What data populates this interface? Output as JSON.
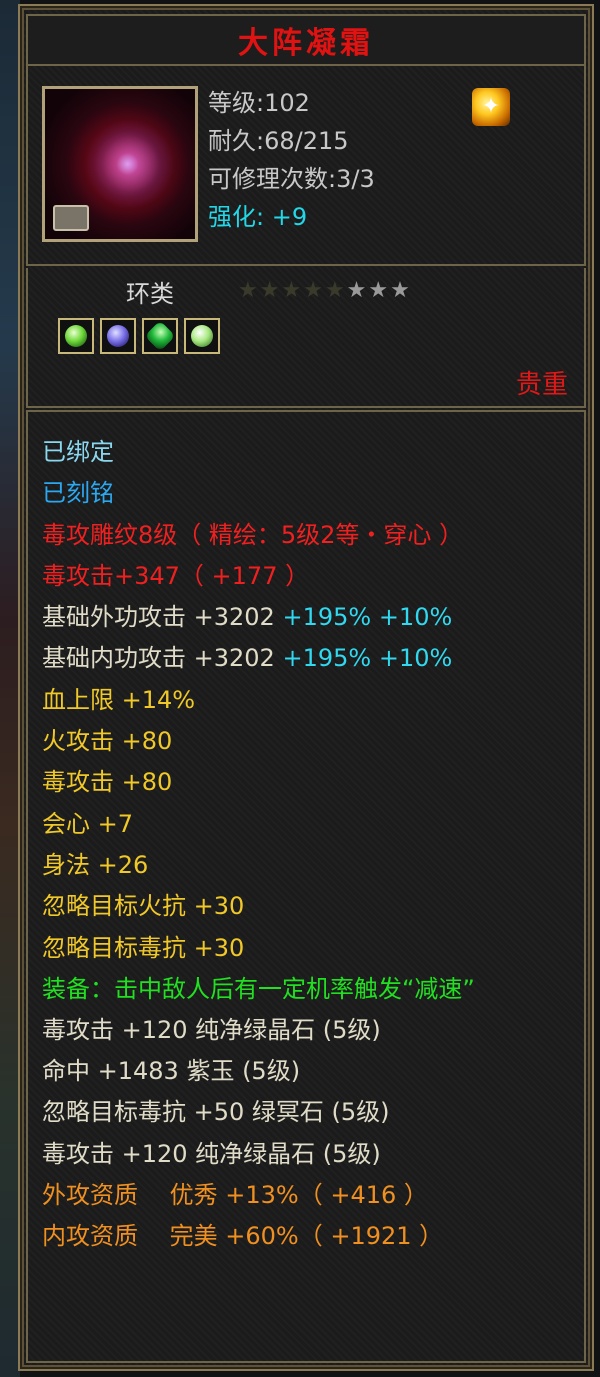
{
  "item": {
    "name": "大阵凝霜",
    "level": "等级:102",
    "durability": "耐久:68/215",
    "repair": "可修理次数:3/3",
    "enhance_label": "强化:",
    "enhance_value": "+9",
    "category": "环类",
    "rarity": "贵重",
    "stars_total": 8,
    "stars_lit": 3,
    "gems": [
      "green",
      "blue",
      "emerald",
      "pale"
    ]
  },
  "props": {
    "bound": "已绑定",
    "engraved": "已刻铭",
    "carve": "毒攻雕纹8级（ 精绘：5级2等・穿心 ）",
    "poison_total": "毒攻击+347（ +177 ）",
    "base_ext": {
      "label": "基础外功攻击 +3202",
      "pct1": "+195%",
      "pct2": "+10%"
    },
    "base_int": {
      "label": "基础内功攻击 +3202",
      "pct1": "+195%",
      "pct2": "+10%"
    },
    "hp": "血上限 +14%",
    "fire": "火攻击 +80",
    "poison": "毒攻击 +80",
    "crit": "会心 +7",
    "agility": "身法 +26",
    "ignore_fire": "忽略目标火抗 +30",
    "ignore_poison": "忽略目标毒抗 +30",
    "equip_effect": "装备：击中敌人后有一定机率触发“减速”",
    "gem1": "毒攻击 +120 纯净绿晶石 (5级)",
    "gem2": "命中 +1483 紫玉 (5级)",
    "gem3": "忽略目标毒抗 +50 绿冥石 (5级)",
    "gem4": "毒攻击 +120 纯净绿晶石 (5级)",
    "ext_quality": "外攻资质　 优秀 +13%（ +416 ）",
    "int_quality": "内攻资质　 完美 +60%（ +1921 ）"
  }
}
